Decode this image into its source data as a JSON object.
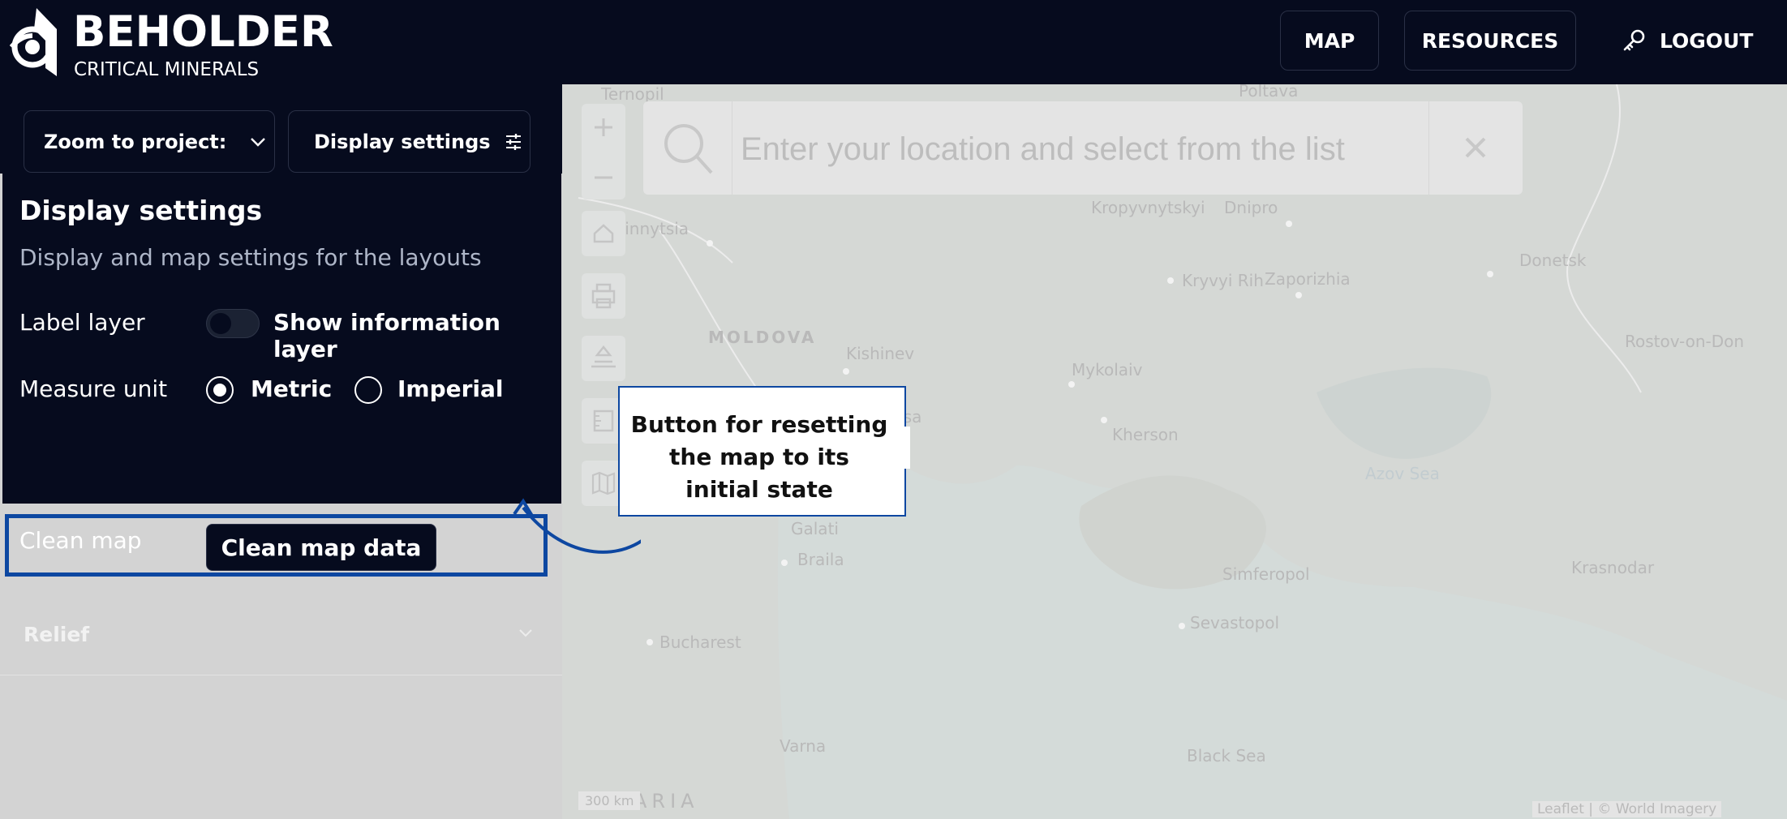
{
  "header": {
    "brand_title": "BEHOLDER",
    "brand_subtitle": "CRITICAL MINERALS",
    "nav": [
      {
        "label": "MAP"
      },
      {
        "label": "RESOURCES"
      }
    ],
    "logout_label": "LOGOUT"
  },
  "sidebar": {
    "zoom_label": "Zoom to project:",
    "display_btn_label": "Display settings",
    "panel": {
      "title": "Display settings",
      "description": "Display and map settings for the layouts",
      "label_layer": {
        "label": "Label layer",
        "toggle_text": "Show information layer",
        "toggle_on": false
      },
      "measure_unit": {
        "label": "Measure unit",
        "options": [
          "Metric",
          "Imperial"
        ],
        "selected": "Metric"
      },
      "clean_map": {
        "label": "Clean map",
        "button": "Clean map data"
      }
    },
    "relief_label": "Relief"
  },
  "map": {
    "search_placeholder": "Enter your location and select from the list",
    "labels": {
      "moldova": "MOLDOVA",
      "kishinev": "Kishinev",
      "odesa": "Odesa",
      "kherson": "Kherson",
      "mykolaiv": "Mykolaiv",
      "kryvyi_rih": "Kryvyi Rih",
      "zaporizhia": "Zaporizhia",
      "dnipro": "Dnipro",
      "kropyvnytskyi": "Kropyvnytskyi",
      "donetsk": "Donetsk",
      "rostov": "Rostov-on-Don",
      "azov": "Azov Sea",
      "krasnodar": "Krasnodar",
      "simferopol": "Simferopol",
      "sevastopol": "Sevastopol",
      "bucharest": "Bucharest",
      "varna": "Varna",
      "black_sea": "Black Sea",
      "galati": "Galati",
      "braila": "Braila",
      "ternopil": "Ternopil",
      "poltava": "Poltava",
      "vinnytsia": "Vinnytsia",
      "bulgaria": "ARIA",
      "scale": "300 km",
      "attribution": "Leaflet | © World Imagery"
    }
  },
  "callout": {
    "text": "Button for resetting the map to its initial state"
  },
  "colors": {
    "header_bg": "#060b1e",
    "highlight": "#0d47a1"
  }
}
